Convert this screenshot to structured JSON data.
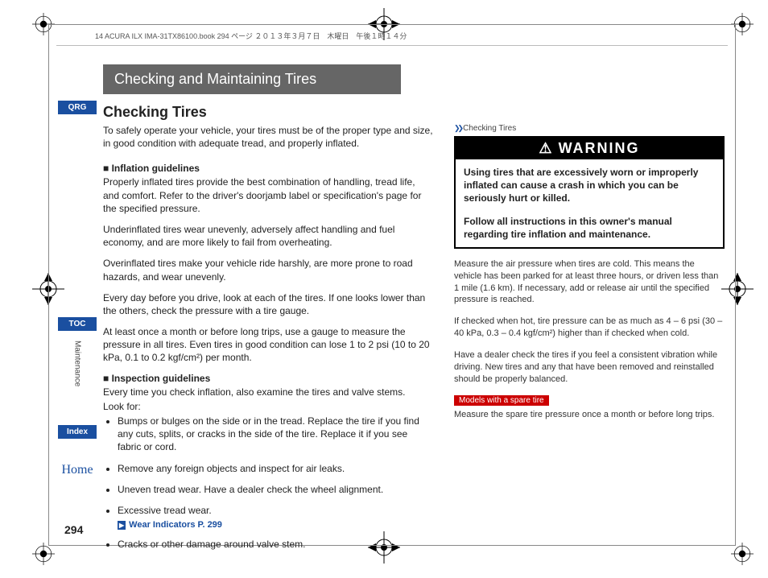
{
  "meta": {
    "bookinfo": "14 ACURA ILX IMA-31TX86100.book  294 ページ  ２０１３年３月７日　木曜日　午後１時１４分"
  },
  "sidebar": {
    "qrg": "QRG",
    "toc": "TOC",
    "section": "Maintenance",
    "index": "Index",
    "home": "Home"
  },
  "chapter_title": "Checking and Maintaining Tires",
  "section_title": "Checking Tires",
  "intro": "To safely operate your vehicle, your tires must be of the proper type and size, in good condition with adequate tread, and properly inflated.",
  "inflation": {
    "heading": "Inflation guidelines",
    "p1": "Properly inflated tires provide the best combination of handling, tread life, and comfort. Refer to the driver's doorjamb label or specification's page for the specified pressure.",
    "p2": "Underinflated tires wear unevenly, adversely affect handling and fuel economy, and are more likely to fail from overheating.",
    "p3": "Overinflated tires make your vehicle ride harshly, are more prone to road hazards, and wear unevenly.",
    "p4": "Every day before you drive, look at each of the tires. If one looks lower than the others, check the pressure with a tire gauge.",
    "p5": "At least once a month or before long trips, use a gauge to measure the pressure in all tires. Even tires in good condition can lose 1 to 2 psi (10 to 20 kPa, 0.1 to 0.2 kgf/cm²) per month."
  },
  "inspection": {
    "heading": "Inspection guidelines",
    "p1": "Every time you check inflation, also examine the tires and valve stems.",
    "lookfor": "Look for:",
    "b1": "Bumps or bulges on the side or in the tread. Replace the tire if you find any cuts, splits, or cracks in the side of the tire. Replace it if you see fabric or cord.",
    "b2": "Remove any foreign objects and inspect for air leaks.",
    "b3": "Uneven tread wear. Have a dealer check the wheel alignment.",
    "b4": "Excessive tread wear.",
    "xref": "Wear Indicators P. 299",
    "b5": "Cracks or other damage around valve stem."
  },
  "side": {
    "head": "Checking Tires",
    "warning_title": "WARNING",
    "warning_p1": "Using tires that are excessively worn or improperly inflated can cause a crash in which you can be seriously hurt or killed.",
    "warning_p2": "Follow all instructions in this owner's manual regarding tire inflation and maintenance.",
    "p1": "Measure the air pressure when tires are cold. This means the vehicle has been parked for at least three hours, or driven less than 1 mile (1.6 km). If necessary, add or release air until the specified pressure is reached.",
    "p2": "If checked when hot, tire pressure can be as much as 4 – 6 psi (30 – 40 kPa, 0.3 – 0.4 kgf/cm²) higher than if checked when cold.",
    "p3": "Have a dealer check the tires if you feel a consistent vibration while driving. New tires and any that have been removed and reinstalled should be properly balanced.",
    "model_tag": "Models with a spare tire",
    "p4": "Measure the spare tire pressure once a month or before long trips."
  },
  "page_number": "294"
}
